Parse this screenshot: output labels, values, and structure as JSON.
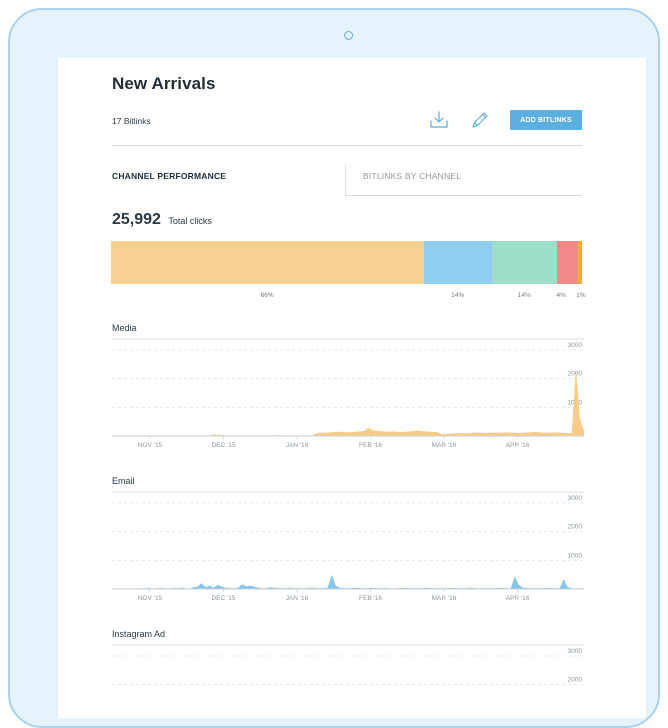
{
  "header": {
    "title": "New Arrivals",
    "bitlinks_count": "17 Bitlinks",
    "add_button_label": "ADD BITLINKS"
  },
  "tabs": [
    {
      "label": "CHANNEL PERFORMANCE",
      "active": true
    },
    {
      "label": "BITLINKS BY CHANNEL",
      "active": false
    }
  ],
  "summary": {
    "total_value": "25,992",
    "total_label": "Total clicks"
  },
  "distribution": {
    "segments": [
      {
        "percent": 66.5,
        "color": "#f7d18f",
        "label": "66%"
      },
      {
        "percent": 14.4,
        "color": "#8fcdf1",
        "label": "14%"
      },
      {
        "percent": 13.9,
        "color": "#9ee0c7",
        "label": "14%"
      },
      {
        "percent": 4.2,
        "color": "#ef8a86",
        "label": "4%"
      },
      {
        "percent": 1.0,
        "color": "#f0a840",
        "label": "1%"
      }
    ]
  },
  "colors": {
    "accent": "#5aaee0",
    "media": "#f6cc86",
    "email": "#86c6ec",
    "ghost": "#ebebeb"
  },
  "icons": {
    "download": "download-icon",
    "edit": "pencil-icon",
    "device_camera": "camera-icon"
  },
  "chart_data": [
    {
      "type": "area",
      "title": "Media",
      "x_ticks": [
        "NOV '15",
        "DEC '15",
        "JAN '16",
        "FEB '16",
        "MAR '16",
        "APR '16"
      ],
      "y_ticks": [
        "1000",
        "2000",
        "3000"
      ],
      "ylim": [
        0,
        3000
      ],
      "series_color": "#f6cc86",
      "values": [
        0,
        0,
        0,
        0,
        0,
        0,
        0,
        0,
        0,
        0,
        0,
        0,
        0,
        0,
        0,
        0,
        0,
        0,
        0,
        0,
        0,
        0,
        0,
        0,
        0,
        60,
        40,
        30,
        0,
        0,
        0,
        0,
        0,
        0,
        0,
        0,
        0,
        0,
        0,
        0,
        20,
        30,
        20,
        0,
        0,
        0,
        0,
        0,
        0,
        0,
        80,
        110,
        120,
        120,
        130,
        140,
        150,
        140,
        130,
        140,
        150,
        160,
        170,
        300,
        200,
        180,
        170,
        160,
        150,
        160,
        150,
        140,
        150,
        160,
        170,
        200,
        170,
        160,
        150,
        140,
        130,
        60,
        70,
        80,
        90,
        100,
        100,
        90,
        100,
        110,
        120,
        110,
        100,
        110,
        120,
        110,
        120,
        130,
        120,
        110,
        100,
        110,
        120,
        130,
        140,
        130,
        120,
        110,
        120,
        130,
        120,
        110,
        100,
        120,
        2350,
        600,
        150
      ]
    },
    {
      "type": "area",
      "title": "Email",
      "x_ticks": [
        "NOV '15",
        "DEC '15",
        "JAN '16",
        "FEB '16",
        "MAR '16",
        "APR '16"
      ],
      "y_ticks": [
        "1000",
        "2000",
        "3000"
      ],
      "ylim": [
        0,
        3000
      ],
      "series_color": "#86c6ec",
      "values": [
        0,
        0,
        0,
        0,
        0,
        0,
        0,
        10,
        20,
        40,
        10,
        20,
        30,
        20,
        10,
        30,
        20,
        40,
        20,
        10,
        60,
        80,
        200,
        60,
        120,
        40,
        150,
        80,
        40,
        30,
        20,
        40,
        160,
        90,
        120,
        80,
        40,
        20,
        30,
        60,
        40,
        30,
        20,
        30,
        40,
        20,
        30,
        20,
        30,
        40,
        30,
        20,
        30,
        40,
        500,
        120,
        40,
        30,
        20,
        30,
        40,
        30,
        20,
        30,
        40,
        30,
        20,
        30,
        20,
        10,
        20,
        30,
        40,
        30,
        20,
        30,
        20,
        40,
        30,
        20,
        30,
        30,
        20,
        30,
        40,
        20,
        30,
        20,
        40,
        30,
        20,
        30,
        20,
        30,
        20,
        40,
        30,
        20,
        20,
        450,
        150,
        40,
        30,
        20,
        30,
        20,
        30,
        40,
        30,
        20,
        30,
        340,
        60,
        20,
        20,
        20,
        20
      ]
    },
    {
      "type": "area",
      "title": "Instagram Ad",
      "y_ticks": [
        "2000",
        "3000"
      ],
      "ylim": [
        0,
        3000
      ],
      "series_color": "#ef8a86",
      "values": []
    }
  ]
}
